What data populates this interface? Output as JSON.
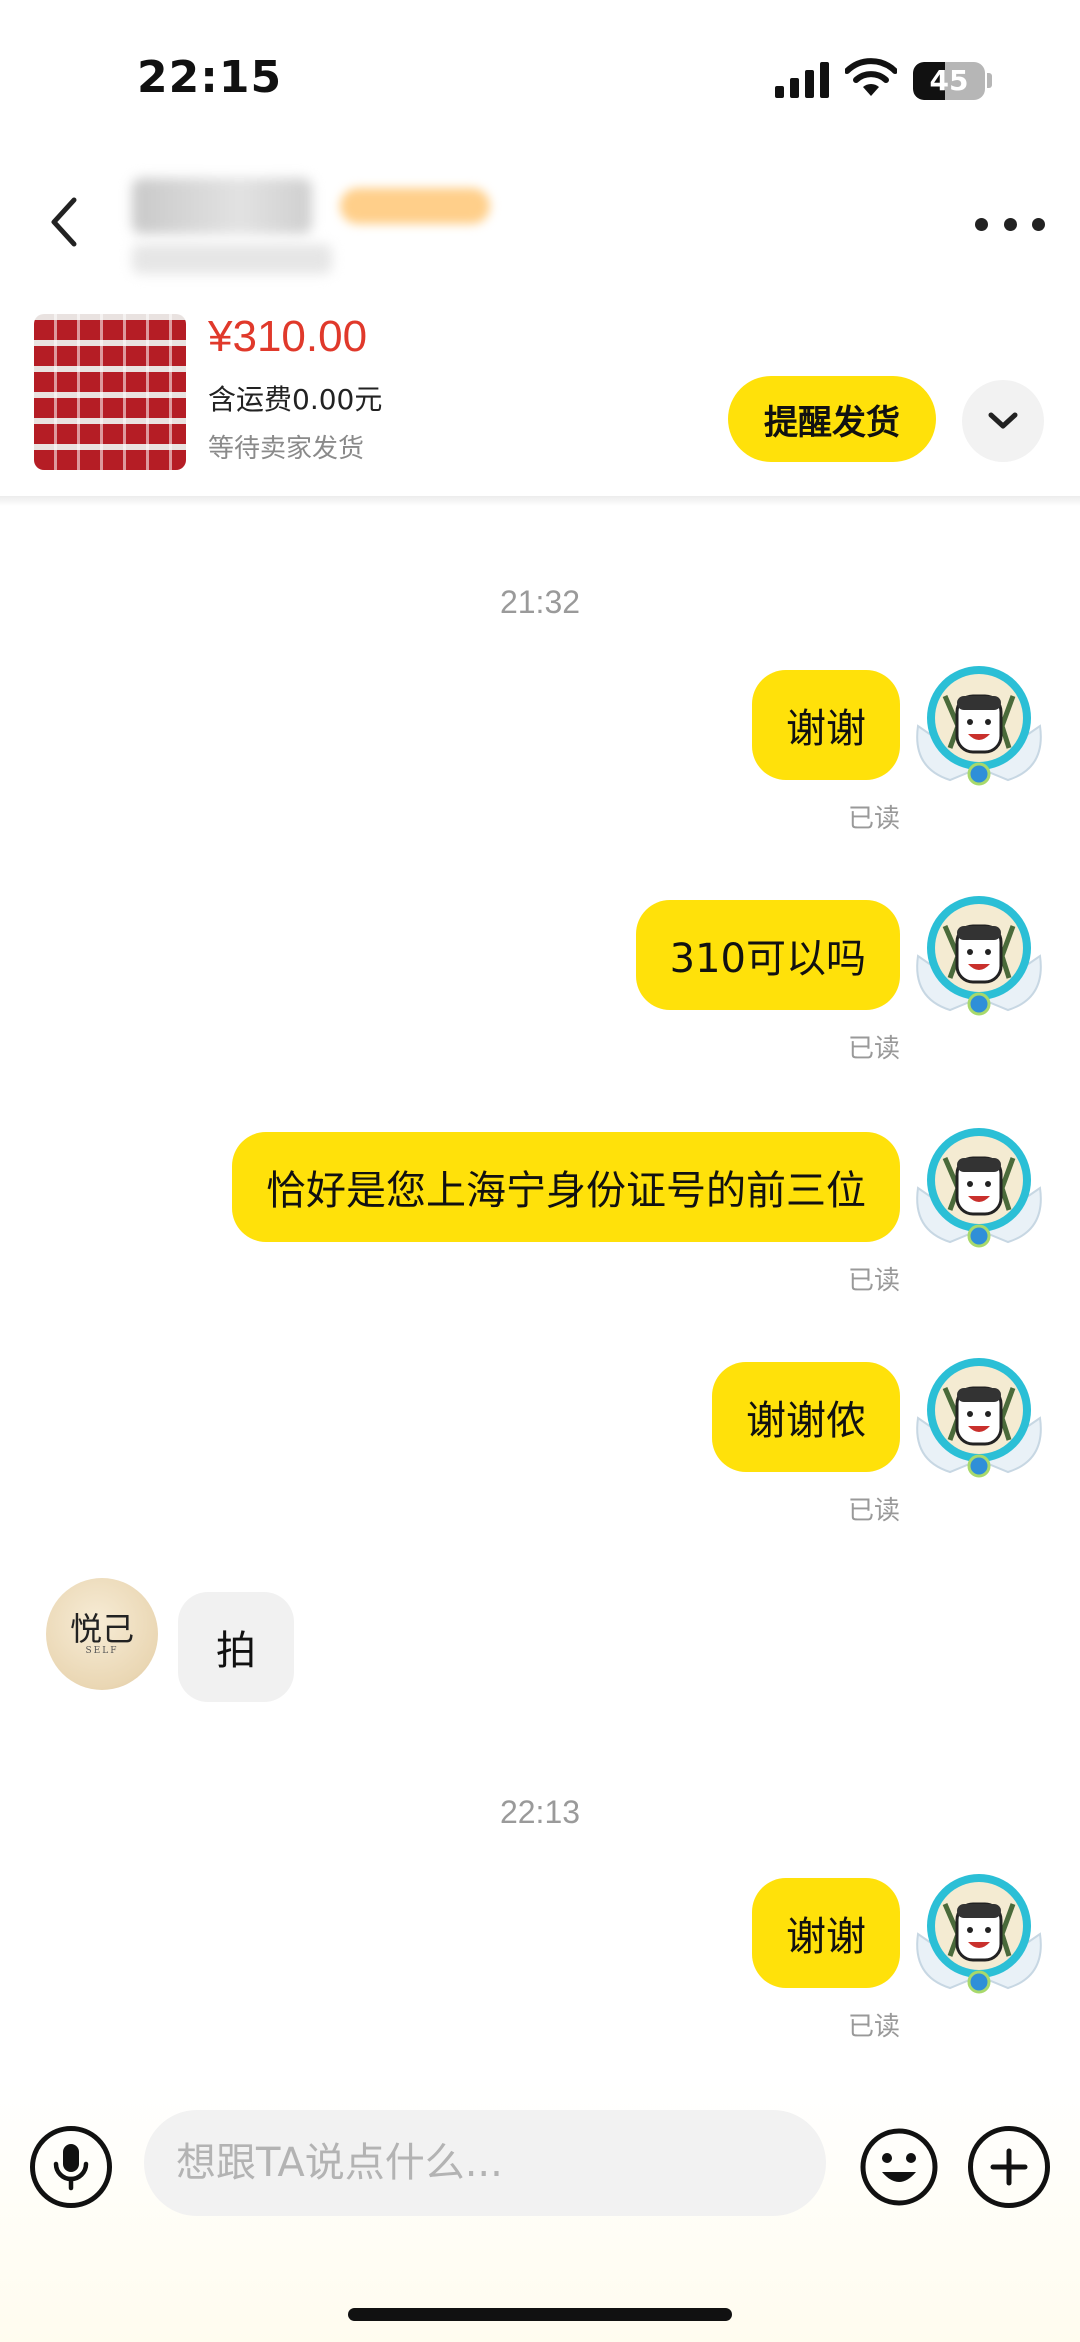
{
  "status_bar": {
    "time": "22:15",
    "battery_level": "45",
    "battery_fraction": 0.45
  },
  "header": {
    "back_icon": "chevron-left-icon",
    "more_icon": "more-horizontal-icon"
  },
  "order": {
    "price": "¥310.00",
    "shipping": "含运费0.00元",
    "status": "等待卖家发货",
    "remind_button": "提醒发货",
    "expand_icon": "chevron-down-icon",
    "price_color": "#e0392b"
  },
  "chat": {
    "timestamps": [
      "21:32",
      "22:13"
    ],
    "read_label": "已读",
    "messages_out": [
      {
        "text": "谢谢"
      },
      {
        "text": "310可以吗"
      },
      {
        "text": "恰好是您上海宁身份证号的前三位"
      },
      {
        "text": "谢谢侬"
      },
      {
        "text": "谢谢"
      }
    ],
    "message_in": {
      "text": "拍"
    },
    "other_avatar": {
      "text": "悦己",
      "subtext": "SELF"
    }
  },
  "input_bar": {
    "placeholder": "想跟TA说点什么...",
    "mic_icon": "microphone-icon",
    "emoji_icon": "emoji-icon",
    "plus_icon": "plus-icon"
  },
  "colors": {
    "accent": "#ffe10a",
    "incoming_bubble": "#f1f1f1",
    "muted_text": "#999999"
  }
}
